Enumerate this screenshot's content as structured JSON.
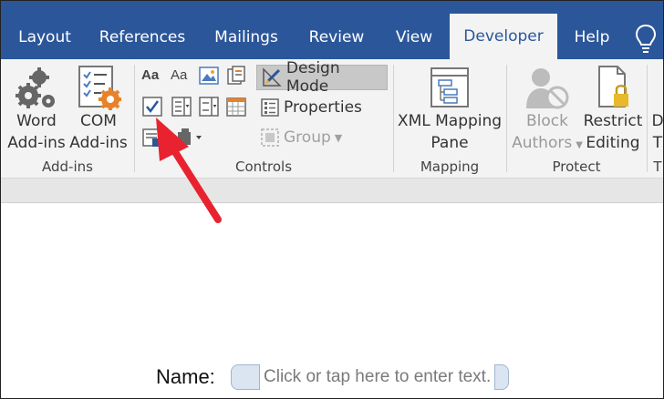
{
  "tabs": [
    {
      "label": "Layout",
      "active": false
    },
    {
      "label": "References",
      "active": false
    },
    {
      "label": "Mailings",
      "active": false
    },
    {
      "label": "Review",
      "active": false
    },
    {
      "label": "View",
      "active": false
    },
    {
      "label": "Developer",
      "active": true
    },
    {
      "label": "Help",
      "active": false
    }
  ],
  "ribbon": {
    "addins": {
      "word_addins": [
        "Word",
        "Add-ins"
      ],
      "com_addins": [
        "COM",
        "Add-ins"
      ],
      "group_label": "Add-ins"
    },
    "controls": {
      "design_mode": "Design Mode",
      "properties": "Properties",
      "group": "Group",
      "group_label": "Controls"
    },
    "mapping": {
      "xml_mapping_pane": [
        "XML Mapping",
        "Pane"
      ],
      "group_label": "Mapping"
    },
    "protect": {
      "block_authors": [
        "Block",
        "Authors"
      ],
      "restrict_editing": [
        "Restrict",
        "Editing"
      ],
      "group_label": "Protect"
    },
    "cutoff": {
      "line1": "D",
      "line2": "T",
      "group_label": "T"
    }
  },
  "document": {
    "field_label": "Name:",
    "placeholder": "Click or tap here to enter text."
  },
  "colors": {
    "tabbar": "#2b579a",
    "ribbon": "#f3f3f3",
    "annotation_arrow": "#e8232f"
  }
}
